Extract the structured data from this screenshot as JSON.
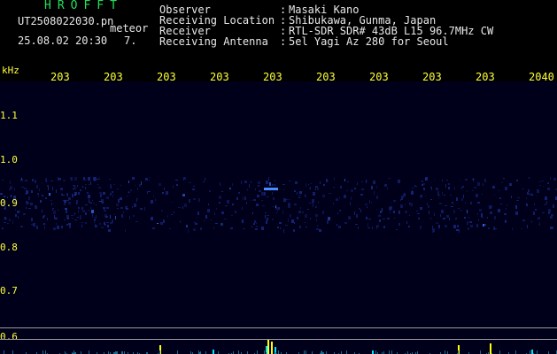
{
  "header": {
    "brand": "HROFFT",
    "file_name": "UT2508022030.pn",
    "file_type": "meteor",
    "date_time": "25.08.02 20:30",
    "count": "7."
  },
  "meta": [
    {
      "label": "Observer",
      "value": "Masaki Kano"
    },
    {
      "label": "Receiving Location",
      "value": "Shibukawa, Gunma, Japan"
    },
    {
      "label": "Receiver",
      "value": "RTL-SDR SDR# 43dB L15 96.7MHz CW"
    },
    {
      "label": "Receiving Antenna",
      "value": "5el Yagi Az 280 for Seoul"
    }
  ],
  "meta_separator": ":",
  "axis": {
    "unit": "kHz",
    "x_ticks": [
      "203",
      "203",
      "203",
      "203",
      "203",
      "203",
      "203",
      "203",
      "203",
      "2040"
    ],
    "y_ticks": [
      "1.1",
      "1.0",
      "0.9",
      "0.8",
      "0.7",
      "0.6"
    ]
  },
  "colors": {
    "background": "#000000",
    "header_green": "#22e05a",
    "header_white": "#e8e8e8",
    "axis_yellow": "#ffff3a",
    "spectrogram_band": "#1a2a8a",
    "spike_yellow": "#ffff00",
    "spike_cyan": "#00e0ff"
  }
}
